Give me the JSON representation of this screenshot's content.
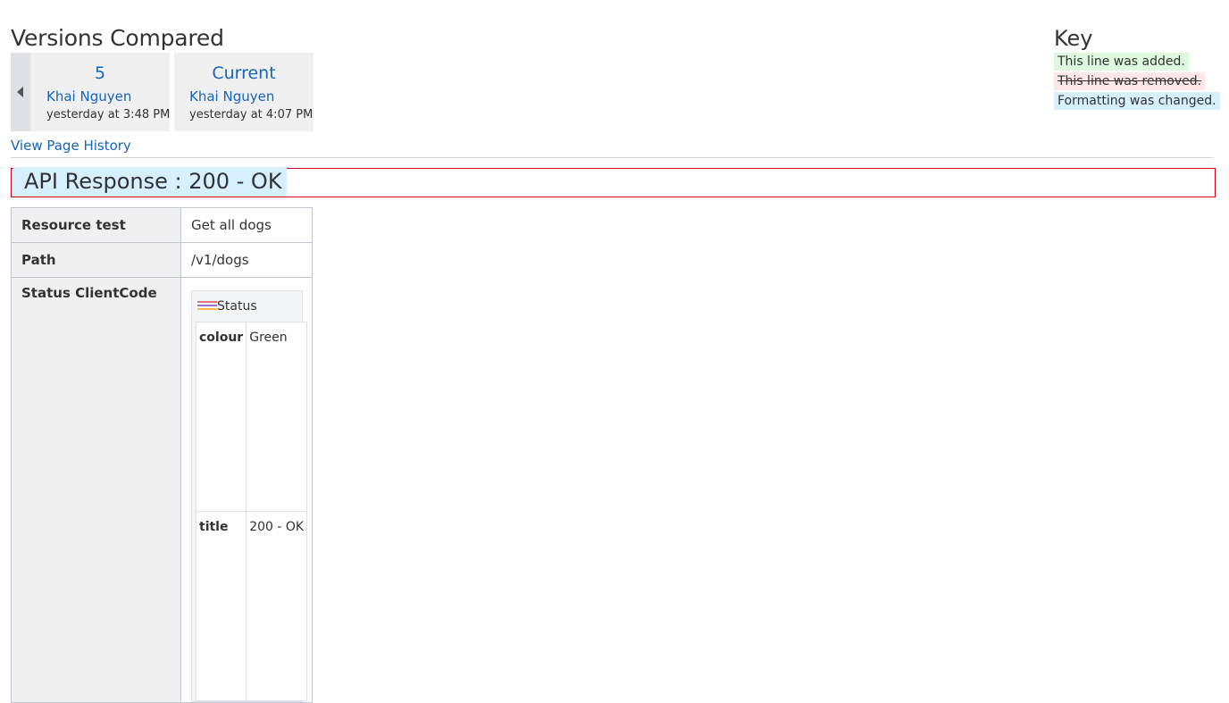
{
  "versions_compared": {
    "title": "Versions Compared",
    "versions": [
      {
        "number": "5",
        "author": "Khai Nguyen",
        "date": "yesterday at 3:48 PM"
      },
      {
        "number": "Current",
        "author": "Khai Nguyen",
        "date": "yesterday at 4:07 PM"
      }
    ],
    "history_link": "View Page History"
  },
  "key": {
    "title": "Key",
    "added": "This line was added.",
    "removed": "This line was removed.",
    "changed": "Formatting was changed.",
    "colors": {
      "added": "#ddfade",
      "removed": "#ffe7e7",
      "changed": "#d6f0ff"
    }
  },
  "content": {
    "heading": "API Response : 200 - OK",
    "table": {
      "rows": [
        {
          "label": "Resource test",
          "value": "Get all dogs"
        },
        {
          "label": "Path",
          "value": "/v1/dogs"
        },
        {
          "label": "Status ClientCode"
        }
      ],
      "status_panel": {
        "title": "Status",
        "rows": [
          {
            "key": "colour",
            "value": "Green"
          },
          {
            "key": "title",
            "value": "200 - OK"
          }
        ]
      }
    }
  },
  "colors": {
    "link": "#1565c0",
    "heading_border": "#d0021b"
  }
}
